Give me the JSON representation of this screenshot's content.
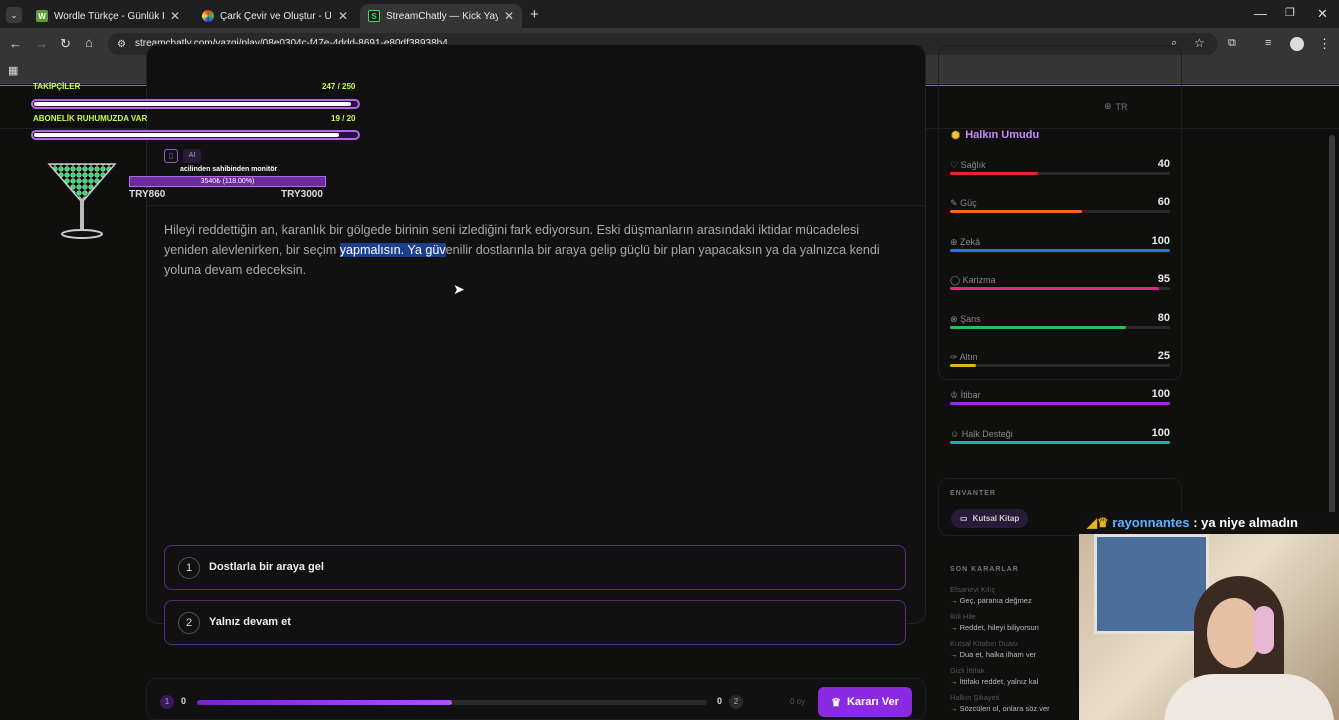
{
  "browser": {
    "tabs": [
      {
        "title": "Wordle Türkçe - Günlük Kelime",
        "favicon": "W"
      },
      {
        "title": "Çark Çevir ve Oluştur - Ücretsiz",
        "favicon": "◐"
      },
      {
        "title": "StreamChatly — Kick Yayıncıları",
        "favicon": "S"
      }
    ],
    "new_tab": "+",
    "url": "streamchatly.com/yazgi/play/08e0304c-f47e-4ddd-8691-e80df38938b4"
  },
  "header": {
    "language": "TR"
  },
  "overlay": {
    "followers_label": "TAKİPÇİLER",
    "followers_value": "247 / 250",
    "followers_progress": 0.988,
    "sub_label": "ABONELİK RUHUMUZDA VAR",
    "sub_value": "19 / 20",
    "sub_progress": 0.95,
    "goal_title": "acilinden sahibinden monitör",
    "goal_progress_text": "3540₺ (118.00%)",
    "goal_min": "TRY860",
    "goal_max": "TRY3000"
  },
  "game": {
    "ai_badge": "AI",
    "story_before": "Hileyi reddettiğin an, karanlık bir gölgede birinin seni izlediğini fark ediyorsun. Eski düşmanların arasındaki iktidar mücadelesi yeniden alevlenirken, bir seçim ",
    "story_highlight": "yapmalısın. Ya güv",
    "story_after": "enilir dostlarınla bir araya gelip güçlü bir plan yapacaksın ya da yalnızca kendi yoluna devam edeceksin.",
    "options": [
      {
        "num": "1",
        "label": "Dostlarla bir araya gel"
      },
      {
        "num": "2",
        "label": "Yalnız devam et"
      }
    ]
  },
  "stats": {
    "title": "Halkın Umudu",
    "items": [
      {
        "name": "Sağlık",
        "value": "40",
        "pct": 40,
        "color": "#e5242f"
      },
      {
        "name": "Güç",
        "value": "60",
        "pct": 60,
        "color": "#f06a1a"
      },
      {
        "name": "Zekâ",
        "value": "100",
        "pct": 100,
        "color": "#2f6fe0"
      },
      {
        "name": "Karizma",
        "value": "95",
        "pct": 95,
        "color": "#e0257d"
      },
      {
        "name": "Şans",
        "value": "80",
        "pct": 80,
        "color": "#21c05a"
      },
      {
        "name": "Altın",
        "value": "25",
        "pct": 12,
        "color": "#e7b416"
      },
      {
        "name": "İtibar",
        "value": "100",
        "pct": 100,
        "color": "#9a2be0"
      },
      {
        "name": "Halk Desteği",
        "value": "100",
        "pct": 100,
        "color": "#13b8a2"
      }
    ]
  },
  "inventory": {
    "title": "ENVANTER",
    "item": "Kutsal Kitap"
  },
  "history": {
    "title": "SON KARARLAR",
    "items": [
      {
        "event": "Efsanevi Kılıç",
        "choice": "→ Geç, paranıa değmez"
      },
      {
        "event": "İkili Hile",
        "choice": "→ Reddet, hileyi biliyorsun"
      },
      {
        "event": "Kutsal Kitabın Duası",
        "choice": "→ Dua et, halka ilham ver"
      },
      {
        "event": "Gizli İttifak",
        "choice": "→ İttifakı reddet, yalnız kal"
      },
      {
        "event": "Halkın Şikayeti",
        "choice": "→ Sözcüleri ol, onlara söz ver"
      }
    ]
  },
  "voting": {
    "left_num": "1",
    "left_votes": "0",
    "right_votes": "0",
    "right_num": "2",
    "left_share": 0.5,
    "votes_label": "0 oy",
    "decide_label": "Kararı Ver"
  },
  "chat": {
    "user": "rayonnantes",
    "message": " : ya niye almadın"
  }
}
